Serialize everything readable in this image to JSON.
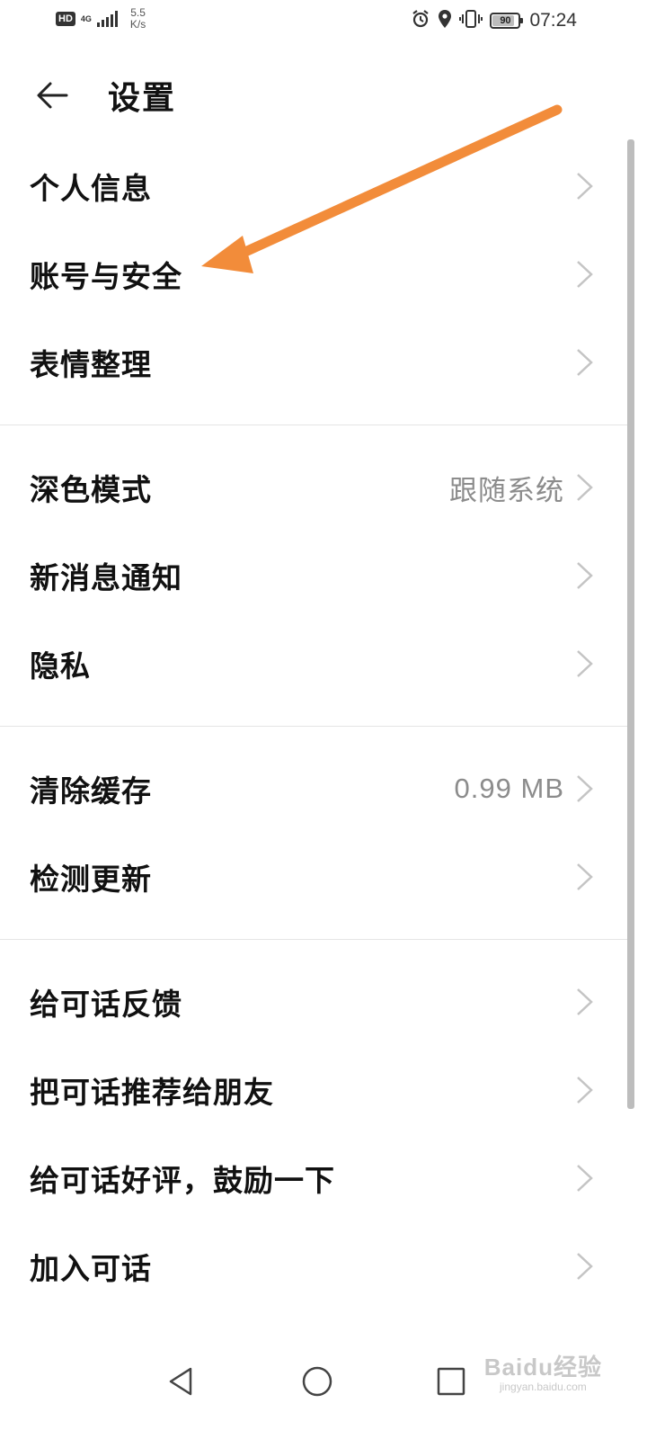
{
  "status_bar": {
    "hd": "HD",
    "network": "4G",
    "speed_value": "5.5",
    "speed_unit": "K/s",
    "battery_level": "90",
    "time": "07:24",
    "icons": [
      "alarm-icon",
      "location-icon",
      "vibrate-icon",
      "battery-icon"
    ]
  },
  "header": {
    "title": "设置",
    "back_icon": "back-arrow-icon"
  },
  "groups": [
    {
      "items": [
        {
          "label": "个人信息",
          "value": ""
        },
        {
          "label": "账号与安全",
          "value": ""
        },
        {
          "label": "表情整理",
          "value": ""
        }
      ]
    },
    {
      "items": [
        {
          "label": "深色模式",
          "value": "跟随系统"
        },
        {
          "label": "新消息通知",
          "value": ""
        },
        {
          "label": "隐私",
          "value": ""
        }
      ]
    },
    {
      "items": [
        {
          "label": "清除缓存",
          "value": "0.99 MB"
        },
        {
          "label": "检测更新",
          "value": ""
        }
      ]
    },
    {
      "items": [
        {
          "label": "给可话反馈",
          "value": ""
        },
        {
          "label": "把可话推荐给朋友",
          "value": ""
        },
        {
          "label": "给可话好评，鼓励一下",
          "value": ""
        },
        {
          "label": "加入可话",
          "value": ""
        }
      ]
    }
  ],
  "annotation": {
    "color": "#f28c3a"
  },
  "nav_bar": {
    "icons": [
      "back-triangle-icon",
      "home-circle-icon",
      "recents-square-icon"
    ]
  },
  "watermark": {
    "main": "Baidu经验",
    "sub": "jingyan.baidu.com"
  }
}
